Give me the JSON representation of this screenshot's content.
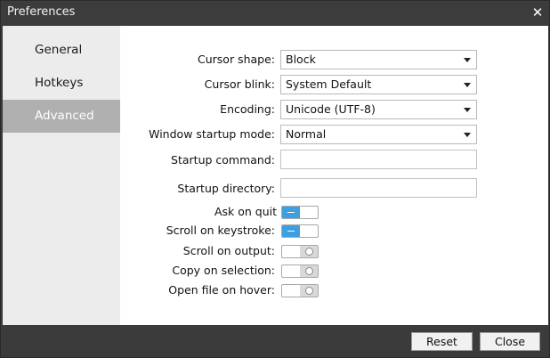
{
  "window": {
    "title": "Preferences"
  },
  "sidebar": {
    "items": [
      {
        "label": "General"
      },
      {
        "label": "Hotkeys"
      },
      {
        "label": "Advanced"
      }
    ]
  },
  "settings": {
    "cursor_shape": {
      "label": "Cursor shape:",
      "value": "Block"
    },
    "cursor_blink": {
      "label": "Cursor blink:",
      "value": "System Default"
    },
    "encoding": {
      "label": "Encoding:",
      "value": "Unicode (UTF-8)"
    },
    "startup_mode": {
      "label": "Window startup mode:",
      "value": "Normal"
    },
    "startup_command": {
      "label": "Startup command:",
      "value": ""
    },
    "startup_directory": {
      "label": "Startup directory:",
      "value": ""
    },
    "ask_on_quit": {
      "label": "Ask on quit",
      "on": true
    },
    "scroll_on_keystroke": {
      "label": "Scroll on keystroke:",
      "on": true
    },
    "scroll_on_output": {
      "label": "Scroll on output:",
      "on": false
    },
    "copy_on_selection": {
      "label": "Copy on selection:",
      "on": false
    },
    "open_file_on_hover": {
      "label": "Open file on hover:",
      "on": false
    }
  },
  "footer": {
    "reset_label": "Reset",
    "close_label": "Close"
  },
  "colors": {
    "toggle_on": "#3d9fe0",
    "sidebar_active": "#b0b0b0",
    "chrome": "#3b3b3b"
  }
}
